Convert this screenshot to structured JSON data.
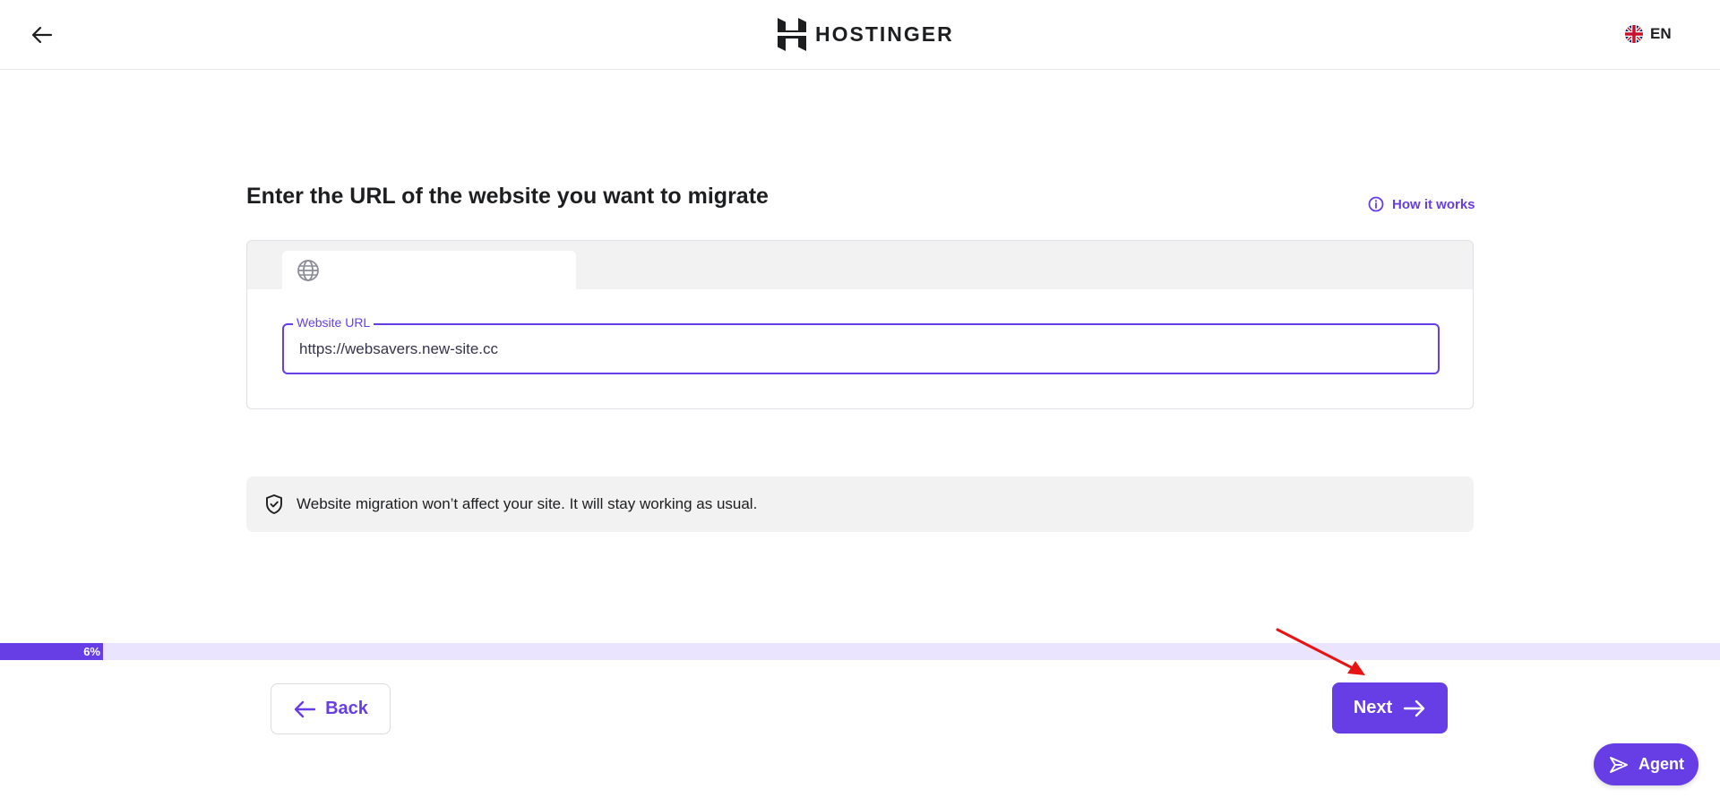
{
  "header": {
    "back_icon": "arrow-left-icon",
    "logo_text": "HOSTINGER",
    "language": "EN",
    "flag_icon": "uk-flag-icon"
  },
  "main": {
    "title": "Enter the URL of the website you want to migrate",
    "how_it_works": "How it works",
    "url_card": {
      "tab_icon": "globe-icon",
      "field_label": "Website URL",
      "field_value": "https://websavers.new-site.cc"
    },
    "notice": {
      "icon": "shield-check-icon",
      "text": "Website migration won’t affect your site. It will stay working as usual."
    }
  },
  "progress": {
    "label": "6%",
    "value": 0.06
  },
  "footer": {
    "back_label": "Back",
    "next_label": "Next",
    "agent_label": "Agent"
  },
  "colors": {
    "accent": "#673de6",
    "progress_track": "#ebe4ff",
    "notice_bg": "#f2f2f2",
    "annotation": "#e81414"
  }
}
